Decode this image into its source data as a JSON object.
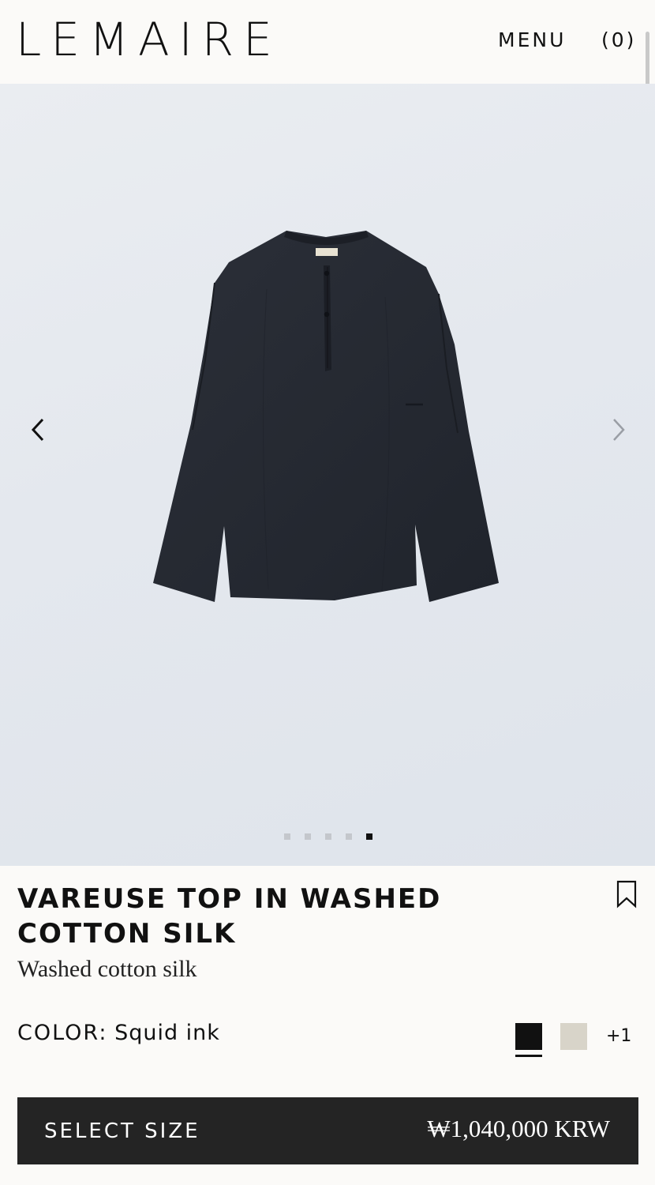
{
  "header": {
    "logo": "LEMAIRE",
    "menu_label": "MENU",
    "cart_label": "(0)"
  },
  "gallery": {
    "slide_count": 5,
    "active_slide": 5,
    "prev_icon": "chevron-left-icon",
    "next_icon": "chevron-right-icon"
  },
  "product": {
    "title": "VAREUSE TOP IN WASHED COTTON SILK",
    "subtitle": "Washed cotton silk",
    "color_label": "COLOR:",
    "color_value": "Squid ink",
    "swatches": [
      {
        "name": "Squid ink",
        "hex": "#111111",
        "selected": true
      },
      {
        "name": "",
        "hex": "#d8d4c9",
        "selected": false
      }
    ],
    "more_colors": "+1"
  },
  "cta": {
    "label": "SELECT SIZE",
    "price": "₩1,040,000 KRW"
  },
  "colors": {
    "background": "#fbfaf8",
    "gallery_bg": "#e4e8ee",
    "shirt": "#262a33",
    "cta_bg": "#242424",
    "text": "#111111"
  }
}
